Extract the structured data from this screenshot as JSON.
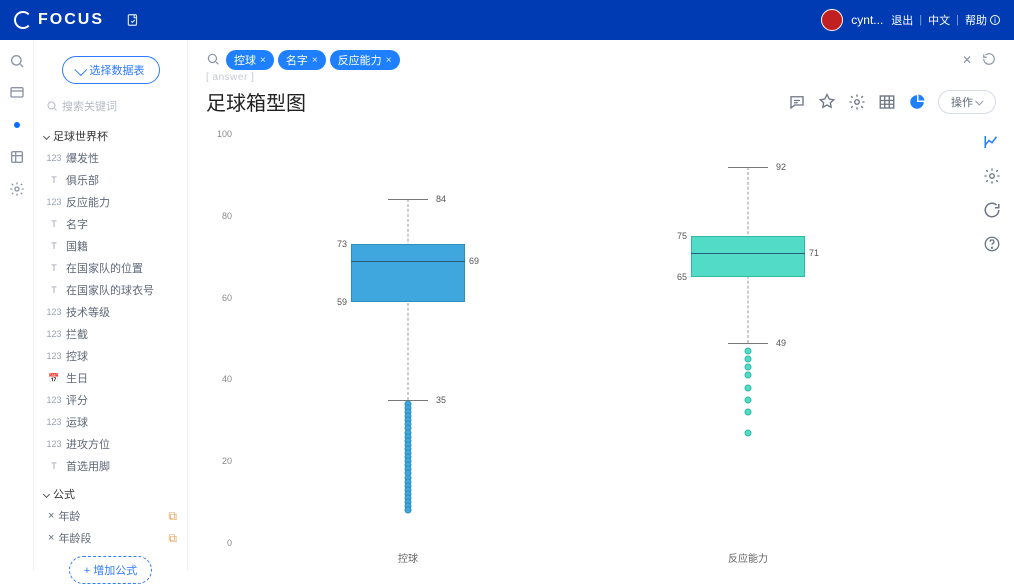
{
  "header": {
    "brand": "FOCUS",
    "username": "cynt...",
    "links": {
      "logout": "退出",
      "lang": "中文",
      "help": "帮助"
    }
  },
  "rail": {
    "active_index": 2
  },
  "side": {
    "select_btn": "选择数据表",
    "search_placeholder": "搜索关键词",
    "group1_title": "足球世界杯",
    "fields": [
      {
        "type": "num",
        "label": "爆发性"
      },
      {
        "type": "txt",
        "label": "俱乐部"
      },
      {
        "type": "num",
        "label": "反应能力"
      },
      {
        "type": "txt",
        "label": "名字"
      },
      {
        "type": "txt",
        "label": "国籍"
      },
      {
        "type": "txt",
        "label": "在国家队的位置"
      },
      {
        "type": "txt",
        "label": "在国家队的球衣号"
      },
      {
        "type": "num",
        "label": "技术等级"
      },
      {
        "type": "num",
        "label": "拦截"
      },
      {
        "type": "num",
        "label": "控球"
      },
      {
        "type": "date",
        "label": "生日"
      },
      {
        "type": "num",
        "label": "评分"
      },
      {
        "type": "num",
        "label": "运球"
      },
      {
        "type": "num",
        "label": "进攻方位"
      },
      {
        "type": "txt",
        "label": "首选用脚"
      }
    ],
    "group2_title": "公式",
    "formulas": [
      {
        "label": "年龄"
      },
      {
        "label": "年龄段"
      }
    ],
    "add_formula": "增加公式"
  },
  "query": {
    "answer_tag": "[ answer ]",
    "pills": [
      "控球",
      "名字",
      "反应能力"
    ]
  },
  "title_row": {
    "title": "足球箱型图",
    "op_label": "操作"
  },
  "chart_data": {
    "type": "boxplot",
    "title": "足球箱型图",
    "y_ticks": [
      0,
      20,
      40,
      60,
      80,
      100
    ],
    "ylim": [
      0,
      100
    ],
    "categories": [
      "控球",
      "反应能力"
    ],
    "series": [
      {
        "name": "控球",
        "color": "#3fa7dd",
        "min": 35,
        "q1": 59,
        "median": 69,
        "q3": 73,
        "max": 84,
        "outliers": [
          34,
          33,
          32,
          31,
          30,
          29,
          28,
          27,
          26,
          25,
          24,
          23,
          22,
          21,
          20,
          19,
          18,
          17,
          16,
          15,
          14,
          13,
          12,
          11,
          10,
          9,
          8
        ]
      },
      {
        "name": "反应能力",
        "color": "#52dcc7",
        "min": 49,
        "q1": 65,
        "median": 71,
        "q3": 75,
        "max": 92,
        "outliers": [
          47,
          45,
          43,
          41,
          38,
          35,
          32,
          27
        ]
      }
    ]
  }
}
